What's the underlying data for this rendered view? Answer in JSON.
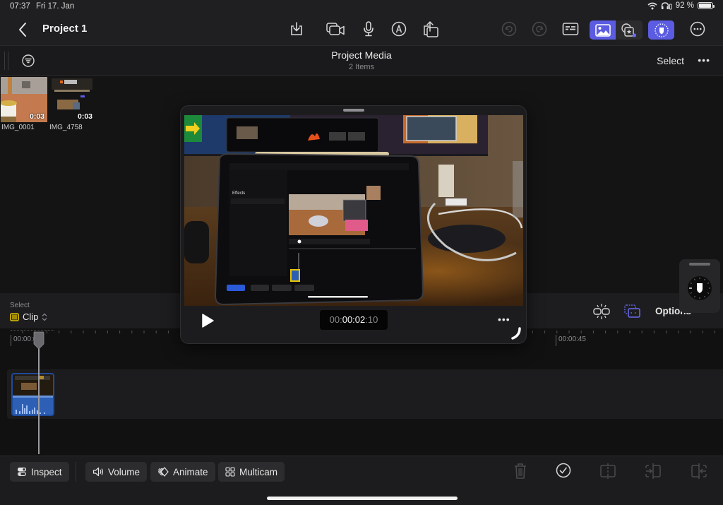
{
  "status_bar": {
    "time": "07:37",
    "date": "Fri 17. Jan",
    "battery_text": "92 %",
    "battery_level": 0.92
  },
  "top_bar": {
    "title": "Project 1",
    "icons": [
      "back-chevron-icon",
      "import-icon",
      "camera-icon",
      "microphone-icon",
      "pencil-icon",
      "share-icon",
      "undo-icon",
      "redo-icon",
      "inspector-icon",
      "media-browser-icon",
      "effects-browser-icon",
      "privacy-icon",
      "more-icon"
    ],
    "accent_color": "#5b5ce2"
  },
  "media_browser": {
    "title": "Project Media",
    "subtitle": "2 Items",
    "select_label": "Select",
    "more_label": "•••",
    "items": [
      {
        "name": "IMG_0001",
        "duration": "0:03"
      },
      {
        "name": "IMG_4758",
        "duration": "0:03"
      }
    ]
  },
  "preview": {
    "timecode_prefix": "00:",
    "timecode_main": "00:02",
    "timecode_sep": ":",
    "timecode_frames": "10",
    "more_label": "•••"
  },
  "timeline": {
    "select_label": "Select",
    "select_value": "Clip",
    "options_label": "Options",
    "ruler_labels": [
      "00:00:00",
      "00:00:45"
    ],
    "clip_color": "#2d5fb5",
    "selection_color": "#e6c700"
  },
  "bottom_toolbar": {
    "inspect_label": "Inspect",
    "volume_label": "Volume",
    "animate_label": "Animate",
    "multicam_label": "Multicam"
  }
}
